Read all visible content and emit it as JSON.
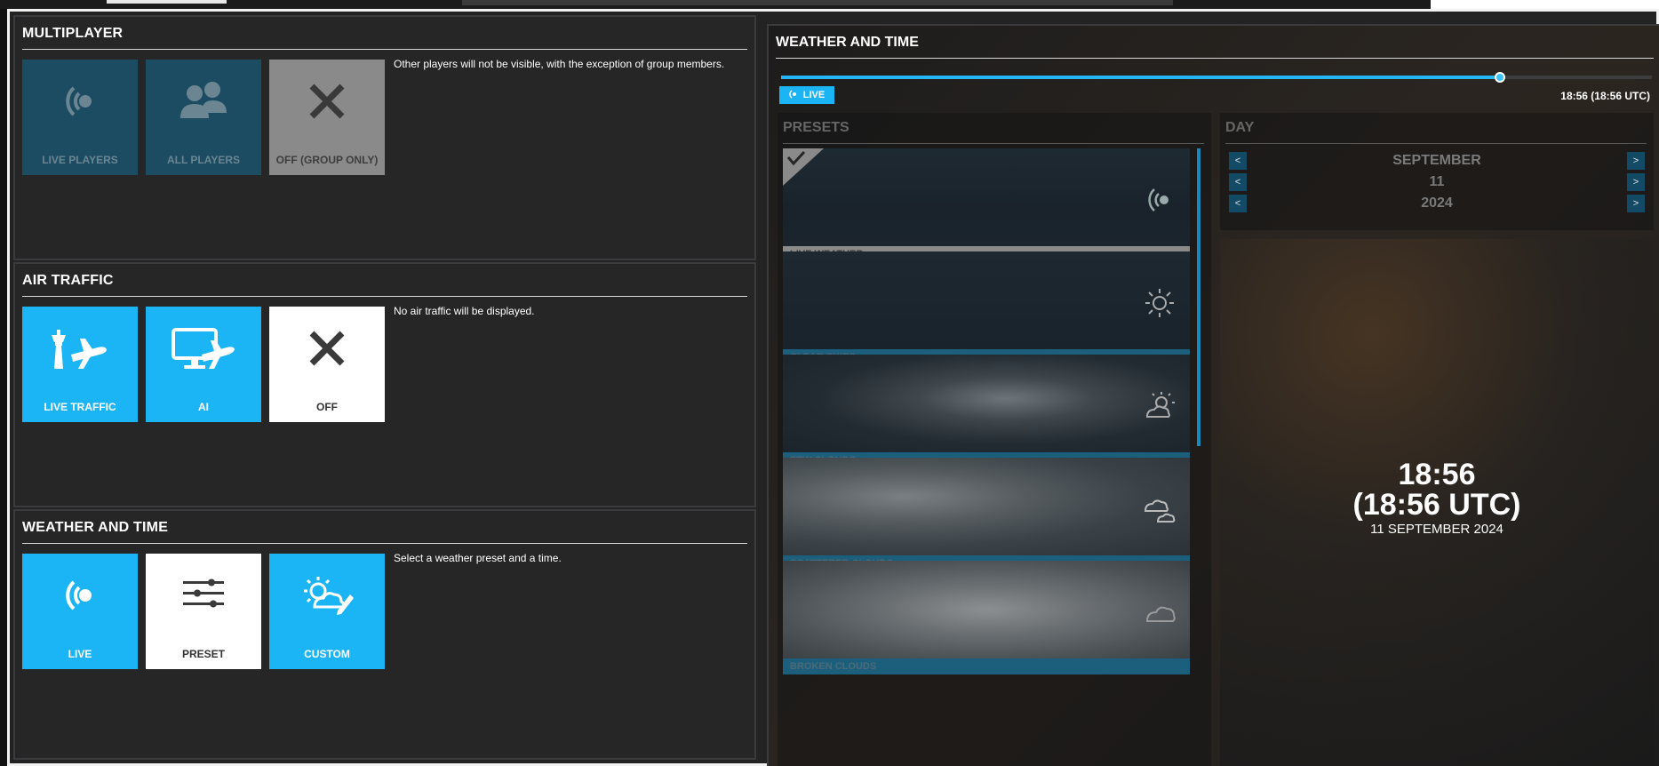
{
  "multiplayer": {
    "title": "MULTIPLAYER",
    "description": "Other players will not be visible, with the exception of group members.",
    "options": [
      {
        "label": "LIVE PLAYERS",
        "icon": "live-signal-icon",
        "state": "disabled"
      },
      {
        "label": "ALL PLAYERS",
        "icon": "users-icon",
        "state": "disabled"
      },
      {
        "label": "OFF (GROUP ONLY)",
        "icon": "close-icon",
        "state": "selected-disabled"
      }
    ]
  },
  "air_traffic": {
    "title": "AIR TRAFFIC",
    "description": "No air traffic will be displayed.",
    "options": [
      {
        "label": "LIVE TRAFFIC",
        "icon": "tower-plane-icon",
        "state": "active"
      },
      {
        "label": "AI",
        "icon": "monitor-plane-icon",
        "state": "active"
      },
      {
        "label": "OFF",
        "icon": "close-icon",
        "state": "selected"
      }
    ]
  },
  "weather_time_left": {
    "title": "WEATHER AND TIME",
    "description": "Select a weather preset and a time.",
    "options": [
      {
        "label": "LIVE",
        "icon": "live-signal-icon",
        "state": "active"
      },
      {
        "label": "PRESET",
        "icon": "sliders-icon",
        "state": "selected"
      },
      {
        "label": "CUSTOM",
        "icon": "weather-edit-icon",
        "state": "active"
      }
    ]
  },
  "weather_time_right": {
    "title": "WEATHER AND TIME",
    "slider": {
      "position_fraction": 0.825
    },
    "live_badge": "LIVE",
    "timecode": "18:56 (18:56 UTC)",
    "presets": {
      "title": "PRESETS",
      "items": [
        {
          "label": "LIVE WEATHER",
          "icon": "live-signal-icon",
          "selected": true
        },
        {
          "label": "CLEAR SKIES",
          "icon": "sun-icon",
          "selected": false
        },
        {
          "label": "FEW CLOUDS",
          "icon": "sun-cloud-icon",
          "selected": false
        },
        {
          "label": "SCATTERED CLOUDS",
          "icon": "clouds-icon",
          "selected": false
        },
        {
          "label": "BROKEN CLOUDS",
          "icon": "cloud-icon",
          "selected": false
        }
      ]
    },
    "day": {
      "title": "DAY",
      "month": "SEPTEMBER",
      "day": "11",
      "year": "2024"
    },
    "clock": {
      "time": "18:56",
      "utc": "(18:56 UTC)",
      "date": "11 SEPTEMBER 2024"
    }
  },
  "colors": {
    "accent": "#1bb4f5",
    "panel": "#262627",
    "disabled_tile": "#1c4c62",
    "caption_blue": "#1c5f7c"
  }
}
